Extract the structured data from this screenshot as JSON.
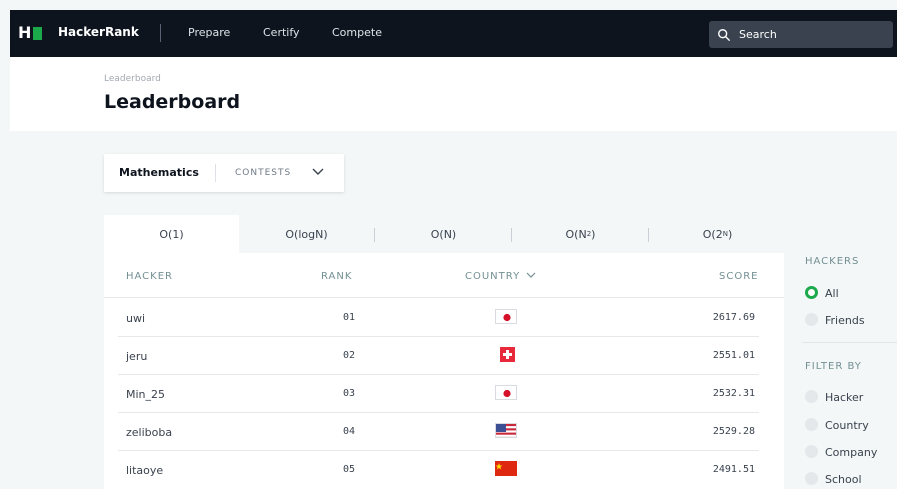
{
  "nav": {
    "logo_letter": "H",
    "brand": "HackerRank",
    "links": [
      "Prepare",
      "Certify",
      "Compete"
    ],
    "search_label": "Search"
  },
  "header": {
    "breadcrumb": "Leaderboard",
    "title": "Leaderboard"
  },
  "track": {
    "name": "Mathematics",
    "contests": "CONTESTS"
  },
  "tabs": [
    "O(1)",
    "O(logN)",
    "O(N)",
    "O(N",
    "O(2"
  ],
  "tab_sups": [
    "",
    "",
    "",
    "2",
    "N"
  ],
  "table": {
    "headers": {
      "hacker": "HACKER",
      "rank": "RANK",
      "country": "COUNTRY",
      "score": "SCORE"
    },
    "rows": [
      {
        "hacker": "uwi",
        "rank": "01",
        "country": "japan-flag",
        "score": "2617.69"
      },
      {
        "hacker": "jeru",
        "rank": "02",
        "country": "switzerland-flag",
        "score": "2551.01"
      },
      {
        "hacker": "Min_25",
        "rank": "03",
        "country": "japan-flag",
        "score": "2532.31"
      },
      {
        "hacker": "zeliboba",
        "rank": "04",
        "country": "usa-flag",
        "score": "2529.28"
      },
      {
        "hacker": "litaoye",
        "rank": "05",
        "country": "china-flag",
        "score": "2491.51"
      }
    ]
  },
  "sidebar": {
    "hackers_heading": "HACKERS",
    "hackers_options": [
      {
        "label": "All",
        "selected": true
      },
      {
        "label": "Friends",
        "selected": false
      }
    ],
    "filter_heading": "FILTER BY",
    "filter_options": [
      "Hacker",
      "Country",
      "Company",
      "School"
    ]
  },
  "colors": {
    "nav_bg": "#0e141e",
    "accent_green": "#1ba94c",
    "page_bg": "#f3f7f7"
  }
}
